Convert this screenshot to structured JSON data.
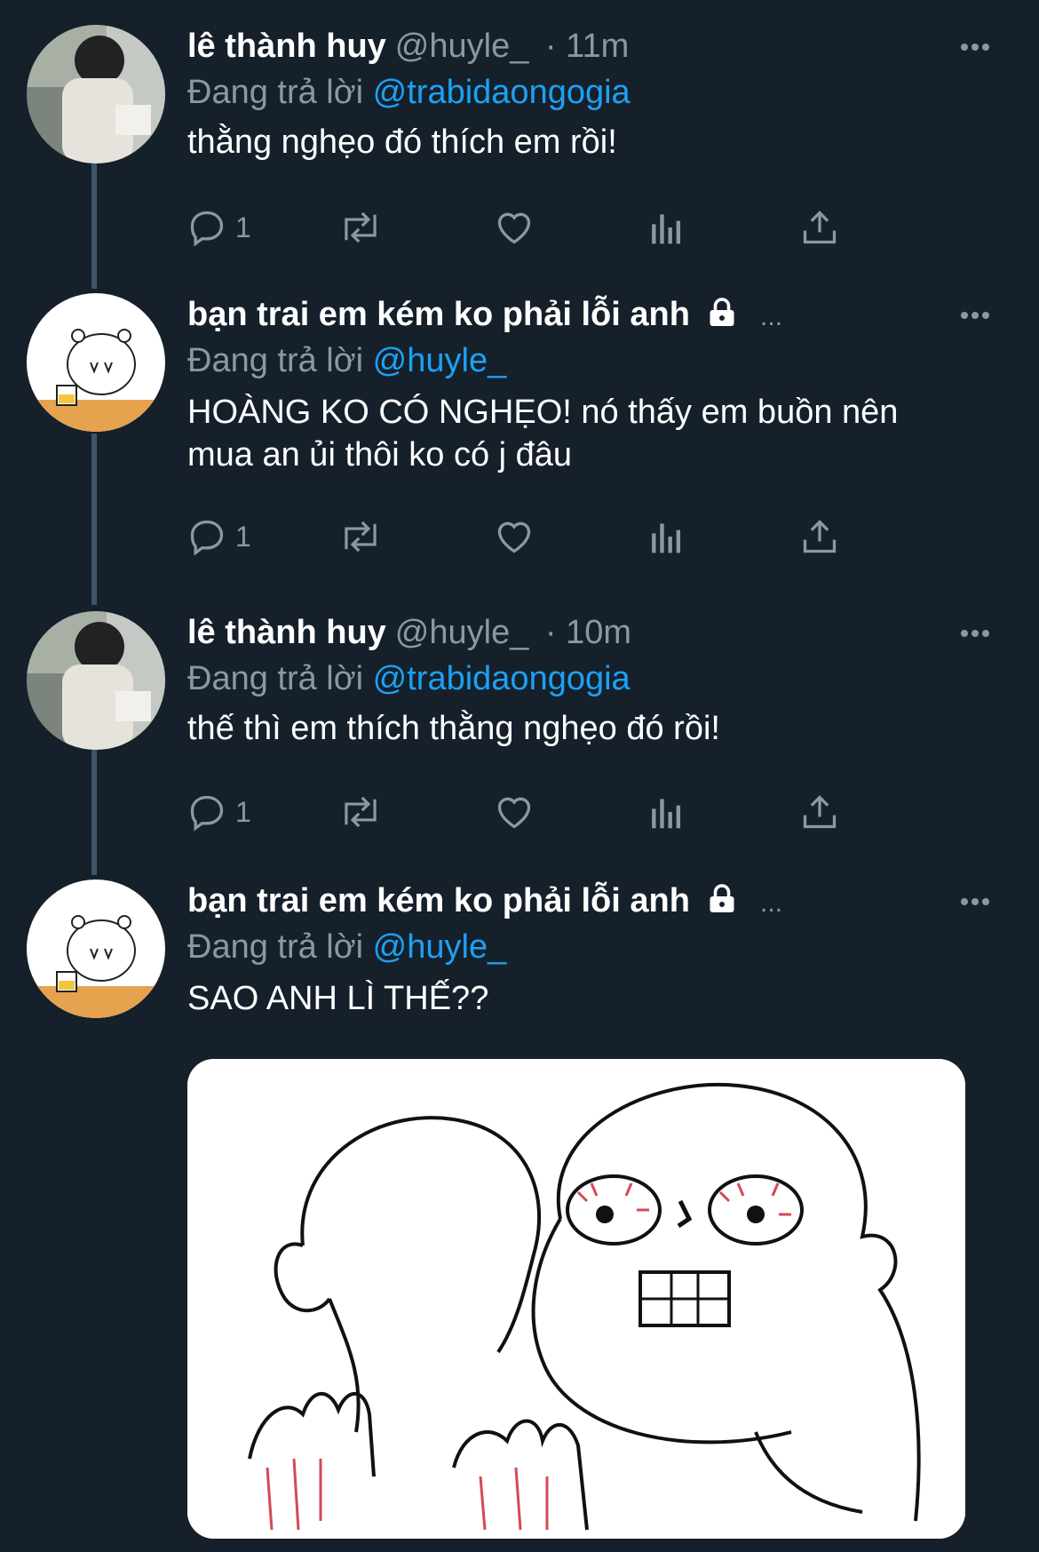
{
  "tweets": [
    {
      "name": "lê thành huy",
      "handle": "@huyle_",
      "time": "· 11m",
      "reply_prefix": "Đang trả lời",
      "reply_to": "@trabidaongogia",
      "text": "thằng nghẹo đó thích em rồi!",
      "reply_count": "1",
      "avatar": "photo-boy-avatar"
    },
    {
      "name": "bạn trai em kém ko phải lỗi anh",
      "handle_truncated": "...",
      "reply_prefix": "Đang trả lời",
      "reply_to": "@huyle_",
      "text": "HOÀNG KO CÓ NGHẸO! nó thấy em buồn nên mua an ủi thôi ko có j đâu",
      "reply_count": "1",
      "avatar": "bear-sticker-avatar",
      "protected": true
    },
    {
      "name": "lê thành huy",
      "handle": "@huyle_",
      "time": "· 10m",
      "reply_prefix": "Đang trả lời",
      "reply_to": "@trabidaongogia",
      "text": "thế thì em thích thằng nghẹo đó rồi!",
      "reply_count": "1",
      "avatar": "photo-boy-avatar"
    },
    {
      "name": "bạn trai em kém ko phải lỗi anh",
      "handle_truncated": "...",
      "reply_prefix": "Đang trả lời",
      "reply_to": "@huyle_",
      "text": "SAO ANH LÌ THẾ??",
      "avatar": "bear-sticker-avatar",
      "protected": true,
      "media": "meme-drawing-image"
    }
  ],
  "colors": {
    "background": "#15202b",
    "secondary_text": "#8899a6",
    "mention": "#1da1f2",
    "thread_line": "#3d5466"
  },
  "icons": [
    "reply-icon",
    "retweet-icon",
    "like-icon",
    "analytics-icon",
    "share-icon",
    "more-icon",
    "lock-icon"
  ]
}
